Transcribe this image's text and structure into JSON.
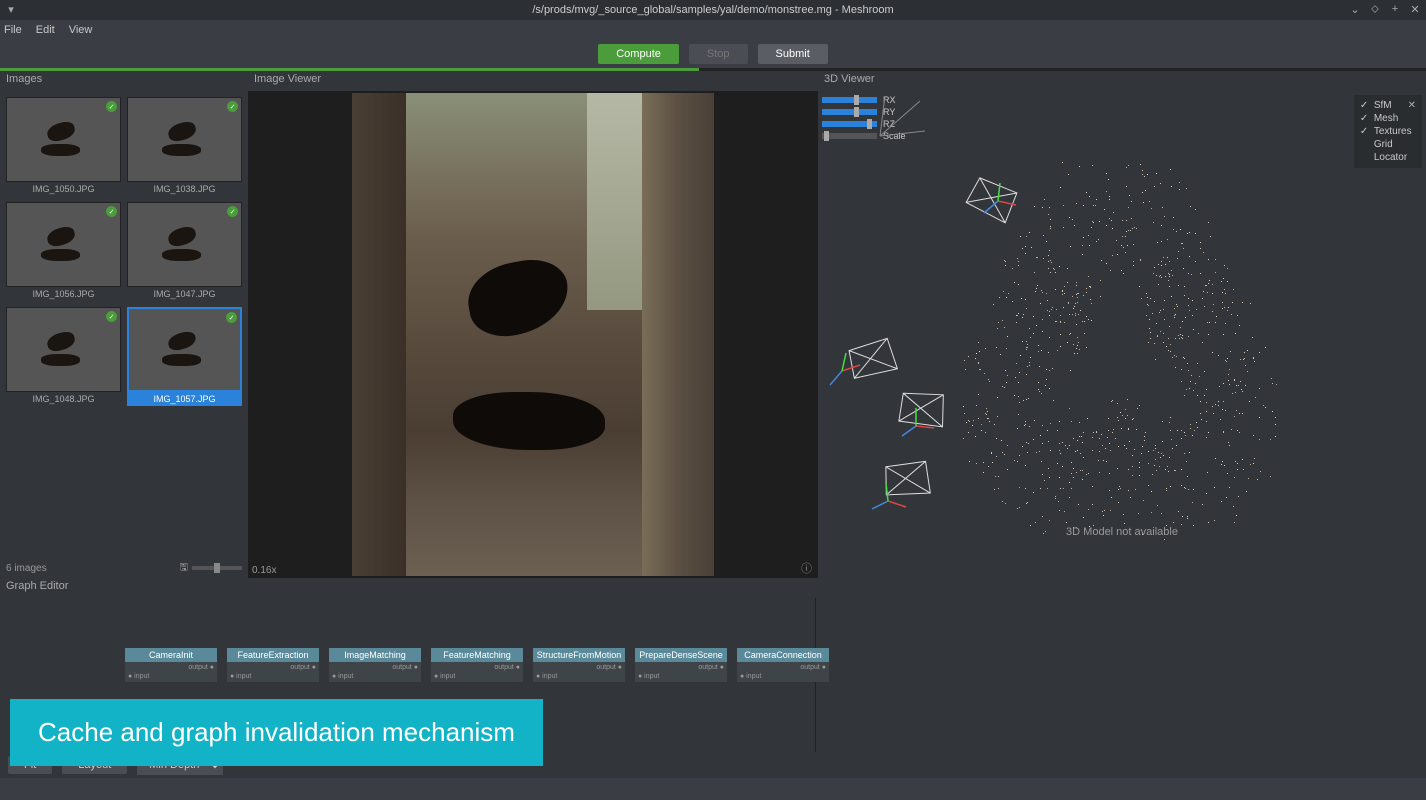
{
  "window": {
    "title": "/s/prods/mvg/_source_global/samples/yal/demo/monstree.mg - Meshroom"
  },
  "menu": {
    "file": "File",
    "edit": "Edit",
    "view": "View"
  },
  "actions": {
    "compute": "Compute",
    "stop": "Stop",
    "submit": "Submit"
  },
  "progress_pct": 49,
  "panels": {
    "images": "Images",
    "image_viewer": "Image Viewer",
    "viewer3d": "3D Viewer",
    "graph_editor": "Graph Editor"
  },
  "images": {
    "count_label": "6 images",
    "items": [
      {
        "name": "IMG_1050.JPG",
        "selected": false
      },
      {
        "name": "IMG_1038.JPG",
        "selected": false
      },
      {
        "name": "IMG_1056.JPG",
        "selected": false
      },
      {
        "name": "IMG_1047.JPG",
        "selected": false
      },
      {
        "name": "IMG_1048.JPG",
        "selected": false
      },
      {
        "name": "IMG_1057.JPG",
        "selected": true
      }
    ]
  },
  "image_viewer": {
    "zoom": "0.16x"
  },
  "viewer3d": {
    "sliders": {
      "rx": "RX",
      "ry": "RY",
      "rz": "RZ",
      "scale": "Scale"
    },
    "layers": {
      "sfm": {
        "label": "SfM",
        "checked": true,
        "closable": true
      },
      "mesh": {
        "label": "Mesh",
        "checked": true
      },
      "tex": {
        "label": "Textures",
        "checked": true
      },
      "grid": {
        "label": "Grid",
        "checked": false
      },
      "loc": {
        "label": "Locator",
        "checked": false
      }
    },
    "message": "3D Model not available"
  },
  "graph": {
    "nodes": [
      "CameraInit",
      "FeatureExtraction",
      "ImageMatching",
      "FeatureMatching",
      "StructureFromMotion",
      "PrepareDenseScene",
      "CameraConnection"
    ],
    "footer": {
      "fit": "Fit",
      "layout": "Layout",
      "depth": "Min Depth"
    }
  },
  "overlay": {
    "caption": "Cache and graph invalidation mechanism"
  }
}
